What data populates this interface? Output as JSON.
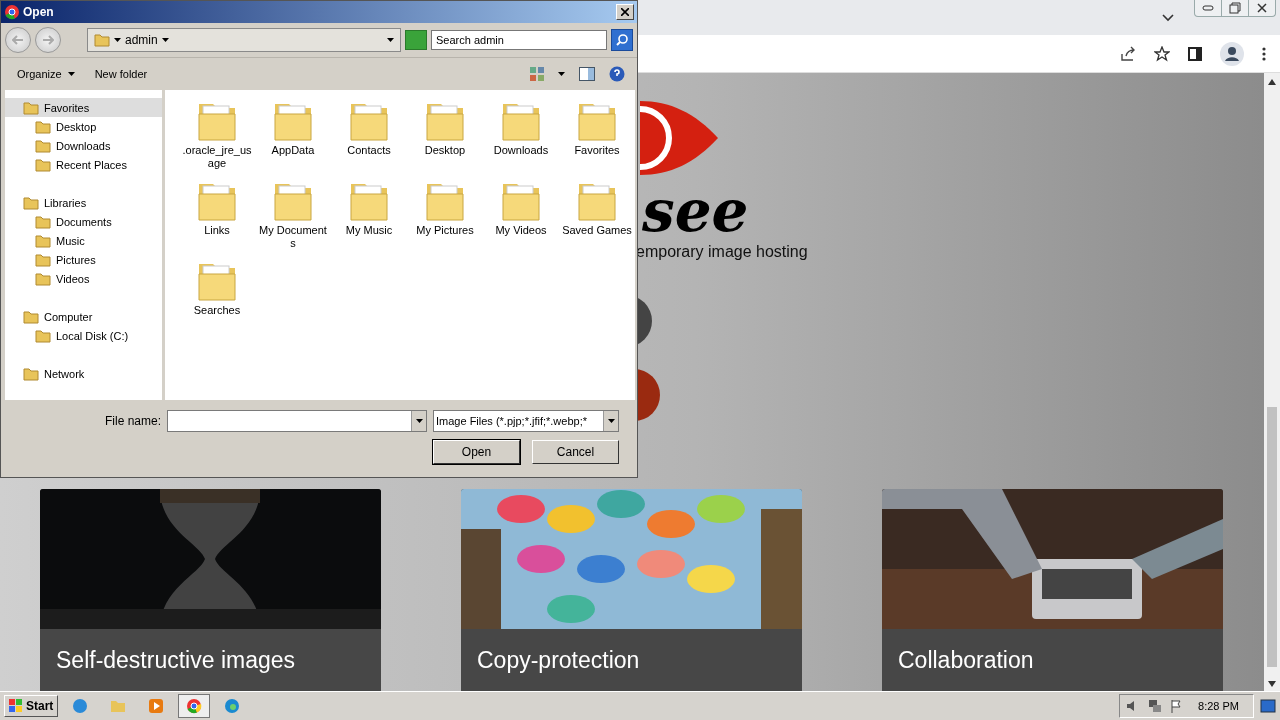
{
  "browser": {
    "logo_text": "see",
    "tagline": "emporary image hosting",
    "cards": [
      {
        "title": "Self-destructive images",
        "kind": "picture"
      },
      {
        "title": "Copy-protection",
        "kind": "picture"
      },
      {
        "title": "Collaboration",
        "kind": "picture"
      }
    ]
  },
  "dialog": {
    "title": "Open",
    "location": "admin",
    "search": {
      "placeholder": "Search admin"
    },
    "toolbar": [
      "Organize",
      "New folder"
    ],
    "nav": [
      {
        "label": "Favorites",
        "selected": true,
        "children": [
          {
            "label": "Desktop",
            "selected": false
          },
          {
            "label": "Downloads",
            "selected": false
          },
          {
            "label": "Recent Places",
            "selected": false
          }
        ]
      },
      {
        "label": "Libraries",
        "selected": false,
        "children": [
          {
            "label": "Documents",
            "selected": false
          },
          {
            "label": "Music",
            "selected": false
          },
          {
            "label": "Pictures",
            "selected": false
          },
          {
            "label": "Videos",
            "selected": false
          }
        ]
      },
      {
        "label": "Computer",
        "selected": false,
        "children": [
          {
            "label": "Local Disk (C:)",
            "selected": false
          }
        ]
      },
      {
        "label": "Network",
        "selected": false
      }
    ],
    "files": [
      ".oracle_jre_usage",
      "AppData",
      "Contacts",
      "Desktop",
      "Downloads",
      "Favorites",
      "Links",
      "My Documents",
      "My Music",
      "My Pictures",
      "My Videos",
      "Saved Games",
      "Searches"
    ],
    "file_name": {
      "label": "File name:"
    },
    "filter": "Image Files (*.pjp;*.jfif;*.webp;*",
    "buttons": [
      "Open",
      "Cancel"
    ]
  },
  "taskbar": {
    "start": "Start",
    "clock": "8:28 PM"
  }
}
